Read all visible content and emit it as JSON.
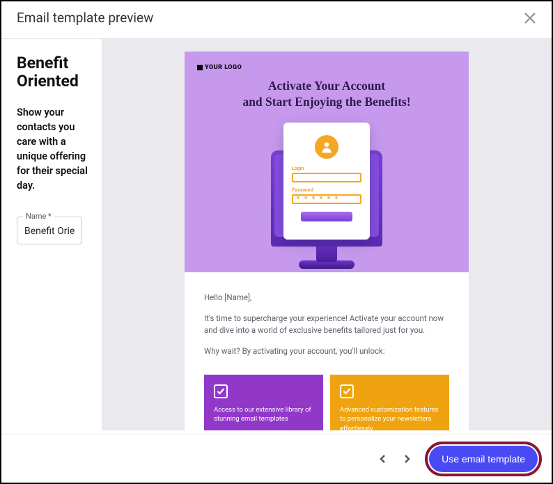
{
  "header": {
    "title": "Email template preview"
  },
  "sidebar": {
    "title": "Benefit Oriented",
    "description": "Show your contacts you care with a unique offering for their special day.",
    "name_label": "Name *",
    "name_value": "Benefit Oriented"
  },
  "email": {
    "logo_text": "YOUR LOGO",
    "hero_line1": "Activate Your Account",
    "hero_line2": "and Start Enjoying the Benefits!",
    "login_label": "Login",
    "password_label": "Password",
    "body_greeting": "Hello [Name],",
    "body_p1": "It's time to supercharge your experience! Activate your account now and dive into a world of exclusive benefits tailored just for you.",
    "body_p2": "Why wait? By activating your account, you'll unlock:",
    "benefit1": "Access to our extensive library of stunning email templates",
    "benefit2": "Advanced customization features to personalize your newsletters effortlessly"
  },
  "footer": {
    "cta": "Use email template"
  }
}
